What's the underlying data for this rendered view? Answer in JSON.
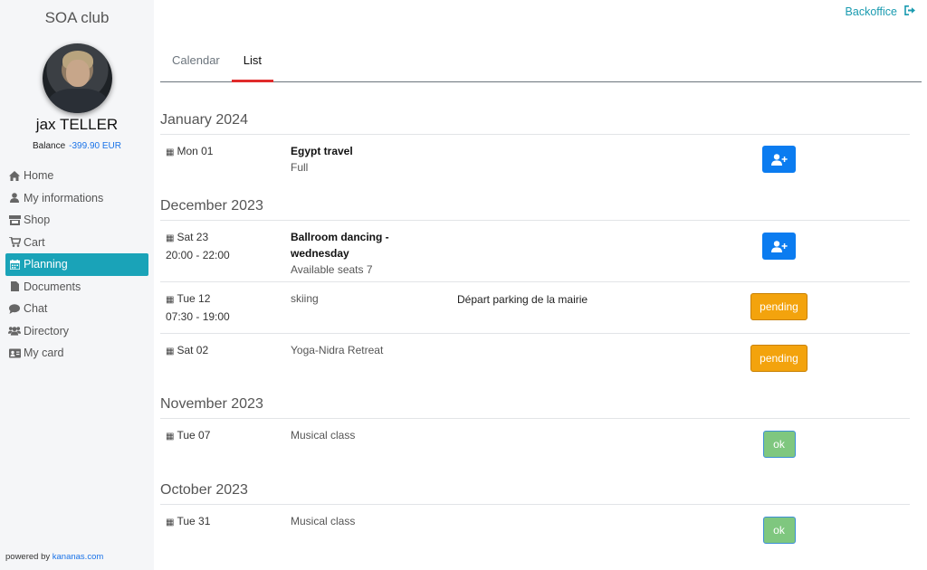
{
  "sidebar": {
    "club_name": "SOA club",
    "user_name": "jax TELLER",
    "balance_label": "Balance",
    "balance_value": "-399.90 EUR",
    "items": [
      {
        "label": "Home",
        "icon": "home-icon"
      },
      {
        "label": "My informations",
        "icon": "user-icon"
      },
      {
        "label": "Shop",
        "icon": "store-icon"
      },
      {
        "label": "Cart",
        "icon": "cart-icon"
      },
      {
        "label": "Planning",
        "icon": "calendar-icon",
        "active": true
      },
      {
        "label": "Documents",
        "icon": "file-icon"
      },
      {
        "label": "Chat",
        "icon": "chat-icon"
      },
      {
        "label": "Directory",
        "icon": "users-icon"
      },
      {
        "label": "My card",
        "icon": "id-card-icon"
      }
    ],
    "powered_prefix": "powered by",
    "powered_link": "kananas.com"
  },
  "header": {
    "backoffice_label": "Backoffice"
  },
  "tabs": [
    {
      "label": "Calendar",
      "active": false
    },
    {
      "label": "List",
      "active": true
    }
  ],
  "months": [
    {
      "title": "January 2024",
      "events": [
        {
          "date": "Mon 01",
          "time": "",
          "title": "Egypt travel",
          "subtitle": "Full",
          "note": "",
          "action": "join"
        }
      ]
    },
    {
      "title": "December 2023",
      "events": [
        {
          "date": "Sat 23",
          "time": "20:00 - 22:00",
          "title": "Ballroom dancing - wednesday",
          "subtitle": "Available seats 7",
          "note": "",
          "action": "join"
        },
        {
          "date": "Tue 12",
          "time": "07:30 - 19:00",
          "title": "skiing",
          "subtitle": "",
          "note": "Départ parking de la mairie",
          "action": "pending",
          "action_label": "pending"
        },
        {
          "date": "Sat 02",
          "time": "",
          "title": "Yoga-Nidra Retreat",
          "subtitle": "",
          "note": "",
          "action": "pending",
          "action_label": "pending"
        }
      ]
    },
    {
      "title": "November 2023",
      "events": [
        {
          "date": "Tue 07",
          "time": "",
          "title": "Musical class",
          "subtitle": "",
          "note": "",
          "action": "ok",
          "action_label": "ok"
        }
      ]
    },
    {
      "title": "October 2023",
      "events": [
        {
          "date": "Tue 31",
          "time": "",
          "title": "Musical class",
          "subtitle": "",
          "note": "",
          "action": "ok",
          "action_label": "ok"
        }
      ]
    }
  ],
  "colors": {
    "accent": "#1aa3b8",
    "join_button": "#0b7cf0",
    "pending_button": "#f3a30d",
    "ok_button": "#7fc77f",
    "tab_underline": "#e02b2b",
    "balance": "#1a73e8"
  }
}
